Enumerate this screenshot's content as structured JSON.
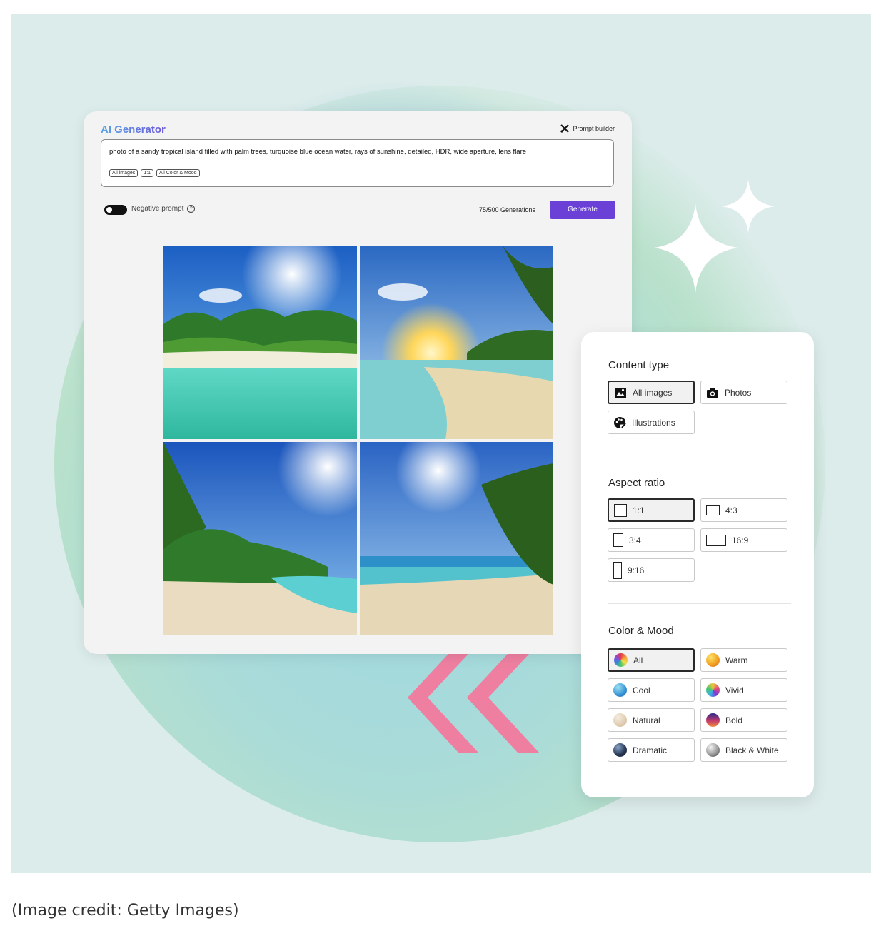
{
  "generator": {
    "title": "AI Generator",
    "prompt_builder_label": "Prompt builder",
    "prompt_text": "photo of a sandy tropical island filled with palm trees, turquoise blue ocean water, rays of sunshine, detailed, HDR, wide aperture, lens flare",
    "chips": [
      "All images",
      "1:1",
      "All Color & Mood"
    ],
    "negative_prompt_label": "Negative prompt",
    "generations_text": "75/500 Generations",
    "generate_label": "Generate",
    "accent_color": "#6a40d6"
  },
  "panel": {
    "content_type": {
      "title": "Content type",
      "options": [
        {
          "label": "All images",
          "icon": "image-icon",
          "selected": true
        },
        {
          "label": "Photos",
          "icon": "camera-icon",
          "selected": false
        },
        {
          "label": "Illustrations",
          "icon": "palette-icon",
          "selected": false
        }
      ]
    },
    "aspect_ratio": {
      "title": "Aspect ratio",
      "options": [
        {
          "label": "1:1",
          "selected": true
        },
        {
          "label": "4:3",
          "selected": false
        },
        {
          "label": "3:4",
          "selected": false
        },
        {
          "label": "16:9",
          "selected": false
        },
        {
          "label": "9:16",
          "selected": false
        }
      ]
    },
    "color_mood": {
      "title": "Color & Mood",
      "options": [
        {
          "label": "All",
          "selected": true
        },
        {
          "label": "Warm",
          "selected": false
        },
        {
          "label": "Cool",
          "selected": false
        },
        {
          "label": "Vivid",
          "selected": false
        },
        {
          "label": "Natural",
          "selected": false
        },
        {
          "label": "Bold",
          "selected": false
        },
        {
          "label": "Dramatic",
          "selected": false
        },
        {
          "label": "Black & White",
          "selected": false
        }
      ]
    }
  },
  "caption": "(Image credit: Getty Images)"
}
